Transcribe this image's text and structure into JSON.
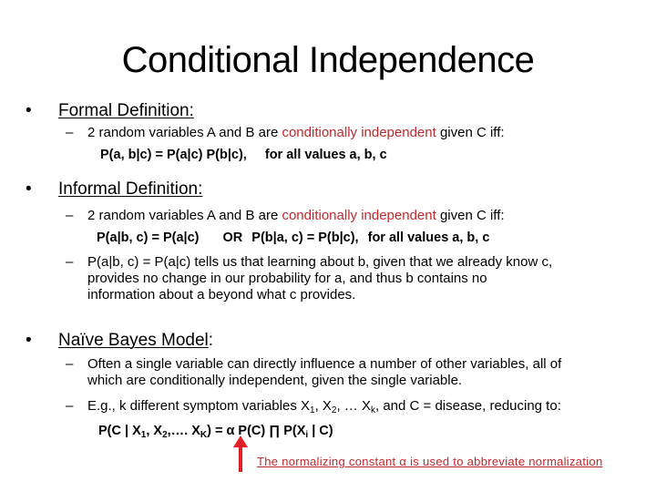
{
  "slide": {
    "title": "Conditional Independence",
    "accent_color": "#c0282c",
    "sections": [
      {
        "bullet": "•",
        "heading": "Formal Definition:",
        "items": [
          {
            "dash": "–",
            "pre": "2 random variables A and B are ",
            "highlight": "conditionally independent",
            "post": " given C iff:",
            "equation": "P(a, b|c) = P(a|c) P(b|c),",
            "qualifier": "for all values a, b, c"
          }
        ]
      },
      {
        "bullet": "•",
        "heading": "Informal Definition:",
        "items": [
          {
            "dash": "–",
            "pre": "2 random variables A and B are ",
            "highlight": "conditionally independent",
            "post": " given C iff:",
            "equation_a": "P(a|b, c) = P(a|c)",
            "or_label": "OR",
            "equation_b": "P(b|a, c) = P(b|c),",
            "qualifier": "for all values a, b, c"
          },
          {
            "dash": "–",
            "lines": [
              "P(a|b, c) = P(a|c) tells us that learning about b, given that we already know c,",
              "provides no change in our probability for a, and thus b contains no",
              "information about a beyond what c provides."
            ]
          }
        ]
      },
      {
        "bullet": "•",
        "heading_underlined": "Naïve Bayes Model",
        "heading_suffix": ":",
        "items": [
          {
            "dash": "–",
            "lines": [
              "Often a single variable can directly influence a number of other variables, all of",
              "which are conditionally independent, given the single variable."
            ]
          },
          {
            "dash": "–",
            "text_pre": "E.g., k different symptom variables X",
            "sub1": "1",
            "sep1": ", X",
            "sub2": "2",
            "sep2": ", … X",
            "subk": "k",
            "text_post": ", and C = disease, reducing to:",
            "formula": {
              "lhs_pre": "P(C | X",
              "lhs_sub1": "1",
              "lhs_mid": ", X",
              "lhs_sub2": "2",
              "lhs_dots": ",…. X",
              "lhs_subk": "K",
              "rhs_pre": ") = ",
              "alpha": "α",
              "rhs_mid": " P(C) ",
              "product": "∏",
              "rhs_term": " P(X",
              "rhs_sub": "i",
              "rhs_end": " | C)"
            }
          }
        ]
      }
    ],
    "annotation": {
      "icon": "up-arrow-icon",
      "text_pre": "The normalizing constant ",
      "alpha": "α",
      "text_post": " is used to abbreviate normalization"
    }
  }
}
